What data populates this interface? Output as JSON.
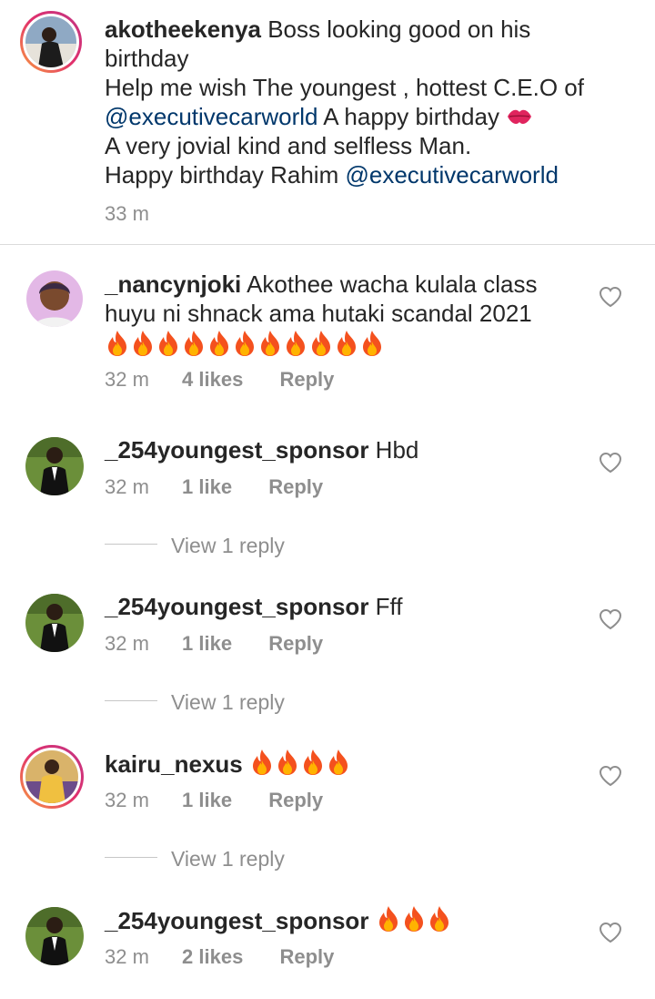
{
  "caption": {
    "username": "akotheekenya",
    "line1": "Boss looking good on his",
    "line2": "birthday",
    "line3": "Help me wish  The youngest , hottest C.E.O of",
    "mention1": "@executivecarworld",
    "line4_rest": " A happy birthday",
    "line5": "A very jovial kind and selfless Man.",
    "line6_pre": "Happy birthday Rahim ",
    "mention2": "@executivecarworld",
    "time": "33 m",
    "kiss_icon": "kiss-mark-icon"
  },
  "comments": [
    {
      "username": "_nancynjoki",
      "text1": "Akothee wacha kulala class",
      "text2": "huyu ni shnack ama hutaki scandal 2021",
      "fire_count": 11,
      "time": "32 m",
      "likes": "4 likes",
      "reply": "Reply"
    },
    {
      "username": "_254youngest_sponsor",
      "text": "Hbd",
      "time": "32 m",
      "likes": "1 like",
      "reply": "Reply",
      "view_replies": "View 1 reply"
    },
    {
      "username": "_254youngest_sponsor",
      "text": "Fff",
      "time": "32 m",
      "likes": "1 like",
      "reply": "Reply",
      "view_replies": "View 1 reply"
    },
    {
      "username": "kairu_nexus",
      "fire_count": 4,
      "time": "32 m",
      "likes": "1 like",
      "reply": "Reply",
      "view_replies": "View 1 reply"
    },
    {
      "username": "_254youngest_sponsor",
      "fire_count": 3,
      "time": "32 m",
      "likes": "2 likes",
      "reply": "Reply"
    }
  ],
  "icons": {
    "like": "heart-outline-icon",
    "fire": "fire-emoji-icon"
  },
  "colors": {
    "mention": "#00376b",
    "meta": "#8e8e8e",
    "text": "#262626"
  }
}
